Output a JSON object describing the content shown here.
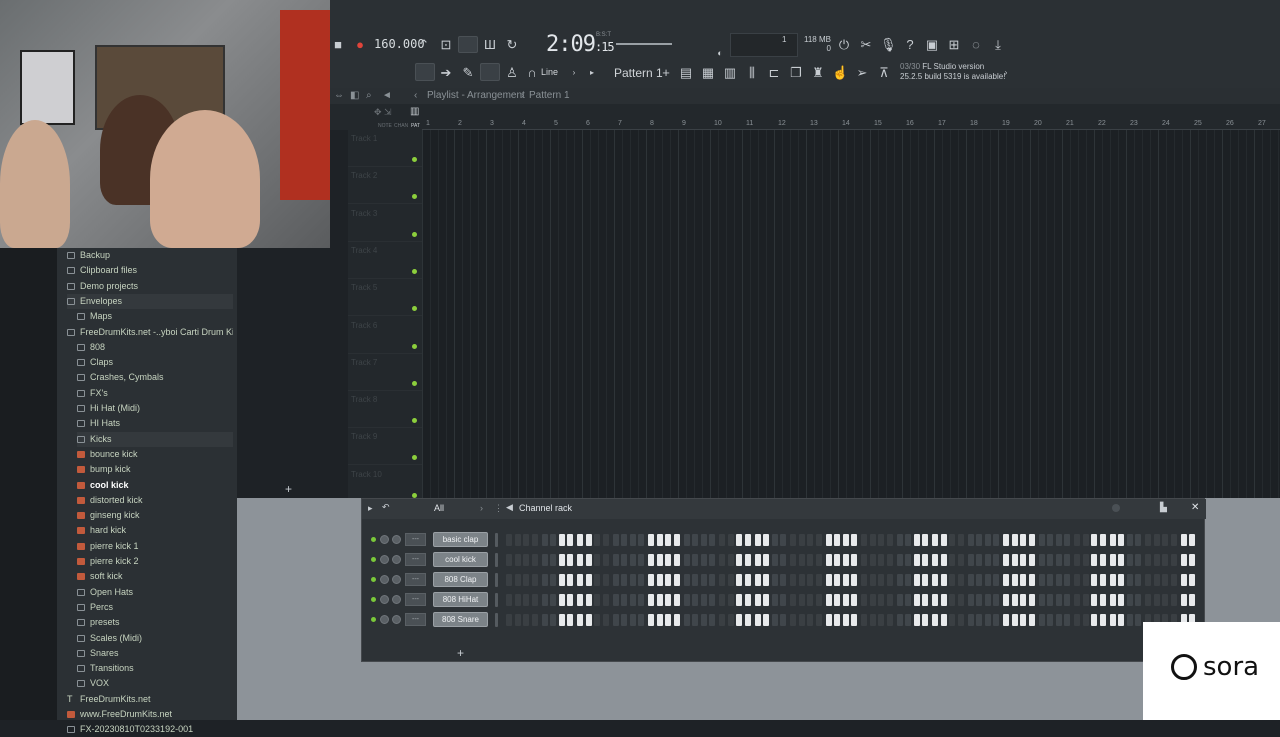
{
  "toolbar": {
    "bpm": "160.000",
    "time_main": "2:09",
    "time_sub": ":15",
    "beat_label": "B:S:T",
    "memory": "118 MB",
    "memory_sub": "0",
    "cpu": "1",
    "pattern": "Pattern 1",
    "snap_mode": "Line",
    "news_count": "03/30",
    "news_line1": "FL Studio version",
    "news_line2": "25.2.5 build 5319 is available!"
  },
  "playlist": {
    "title": "Playlist - Arrangement",
    "crumb": "Pattern 1",
    "ruler_ticks": [
      "1",
      "2",
      "3",
      "4",
      "5",
      "6",
      "7",
      "8",
      "9",
      "10",
      "11",
      "12",
      "13",
      "14",
      "15",
      "16",
      "17",
      "18",
      "19",
      "20",
      "21",
      "22",
      "23",
      "24",
      "25",
      "26",
      "27"
    ],
    "tracks": [
      "Track 1",
      "Track 2",
      "Track 3",
      "Track 4",
      "Track 5",
      "Track 6",
      "Track 7",
      "Track 8",
      "Track 9",
      "Track 10"
    ],
    "note_label": "NOTE",
    "chan_label": "CHAN",
    "pat_label": "PAT"
  },
  "browser": {
    "items": [
      {
        "label": "Backup",
        "kind": "folder",
        "level": 0
      },
      {
        "label": "Clipboard files",
        "kind": "folder",
        "level": 0
      },
      {
        "label": "Demo projects",
        "kind": "folder",
        "level": 0
      },
      {
        "label": "Envelopes",
        "kind": "folder",
        "level": 0
      },
      {
        "label": "Maps",
        "kind": "folder",
        "level": 1
      },
      {
        "label": "FreeDrumKits.net -..yboi Carti Drum Kit",
        "kind": "folder",
        "level": 0
      },
      {
        "label": "808",
        "kind": "folder",
        "level": 1
      },
      {
        "label": "Claps",
        "kind": "folder",
        "level": 1
      },
      {
        "label": "Crashes, Cymbals",
        "kind": "folder",
        "level": 1
      },
      {
        "label": "FX's",
        "kind": "folder",
        "level": 1
      },
      {
        "label": "Hi Hat (Midi)",
        "kind": "folder",
        "level": 1
      },
      {
        "label": "HI Hats",
        "kind": "folder",
        "level": 1
      },
      {
        "label": "Kicks",
        "kind": "folder",
        "level": 1
      },
      {
        "label": "bounce kick",
        "kind": "file",
        "level": 1
      },
      {
        "label": "bump kick",
        "kind": "file",
        "level": 1
      },
      {
        "label": "cool kick",
        "kind": "file",
        "level": 1
      },
      {
        "label": "distorted kick",
        "kind": "file",
        "level": 1
      },
      {
        "label": "ginseng kick",
        "kind": "file",
        "level": 1
      },
      {
        "label": "hard kick",
        "kind": "file",
        "level": 1
      },
      {
        "label": "pierre kick 1",
        "kind": "file",
        "level": 1
      },
      {
        "label": "pierre kick 2",
        "kind": "file",
        "level": 1
      },
      {
        "label": "soft kick",
        "kind": "file",
        "level": 1
      },
      {
        "label": "Open Hats",
        "kind": "folder",
        "level": 1
      },
      {
        "label": "Percs",
        "kind": "folder",
        "level": 1
      },
      {
        "label": "presets",
        "kind": "folder",
        "level": 1
      },
      {
        "label": "Scales (Midi)",
        "kind": "folder",
        "level": 1
      },
      {
        "label": "Snares",
        "kind": "folder",
        "level": 1
      },
      {
        "label": "Transitions",
        "kind": "folder",
        "level": 1
      },
      {
        "label": "VOX",
        "kind": "folder",
        "level": 1
      },
      {
        "label": "FreeDrumKits.net",
        "kind": "text",
        "level": 0
      },
      {
        "label": "www.FreeDrumKits.net",
        "kind": "file",
        "level": 0
      },
      {
        "label": "FX-20230810T0233192-001",
        "kind": "folder",
        "level": 0
      }
    ]
  },
  "channel_rack": {
    "title": "Channel rack",
    "filter": "All",
    "channels": [
      {
        "name": "basic clap"
      },
      {
        "name": "cool kick"
      },
      {
        "name": "808 Clap"
      },
      {
        "name": "808 HiHat"
      },
      {
        "name": "808 Snare"
      }
    ],
    "mixer_label": "---"
  },
  "badge": {
    "text": "sora"
  }
}
